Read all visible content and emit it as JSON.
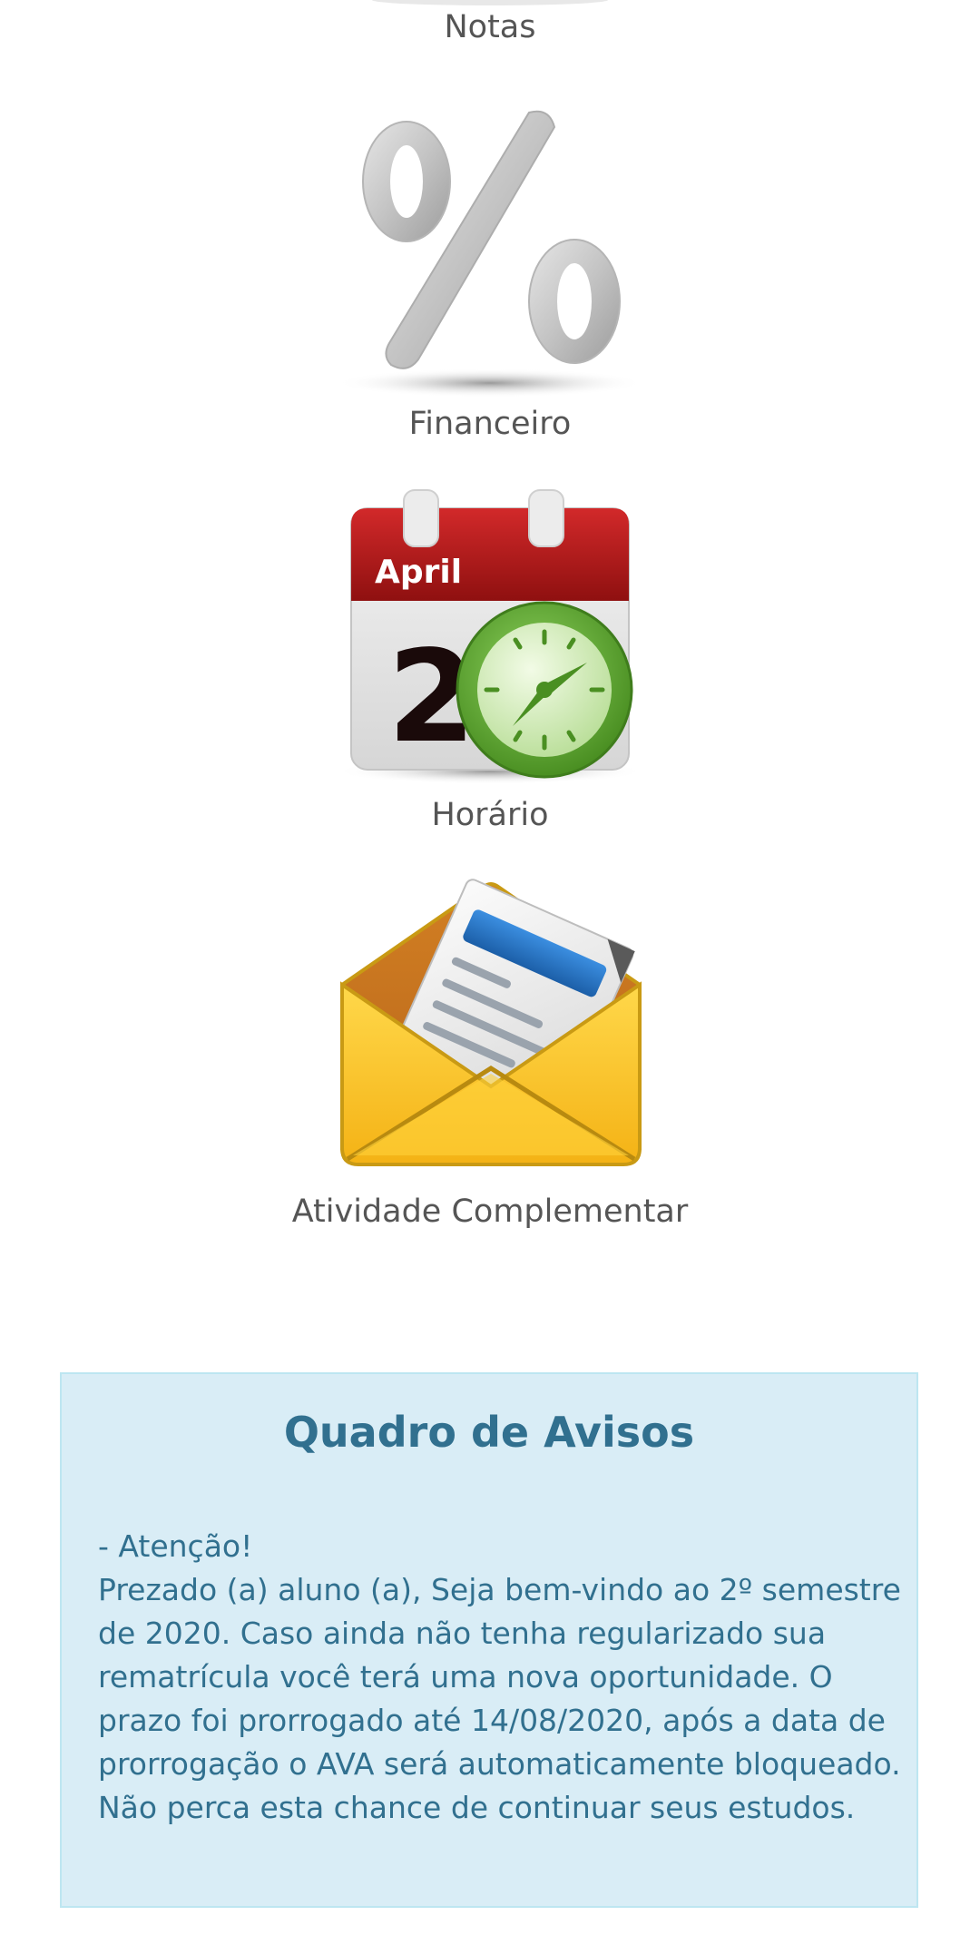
{
  "menu": {
    "items": [
      {
        "label": "Notas",
        "icon": "notas-icon"
      },
      {
        "label": "Financeiro",
        "icon": "percent-icon"
      },
      {
        "label": "Horário",
        "icon": "calendar-clock-icon",
        "calendar_month": "April",
        "calendar_day": "2"
      },
      {
        "label": "Atividade Complementar",
        "icon": "envelope-document-icon"
      }
    ]
  },
  "notice_board": {
    "title": "Quadro de Avisos",
    "heading": "- Atenção!",
    "lines": [
      "Prezado (a) aluno (a), Seja bem-vindo ao 2º semestre",
      "de 2020. Caso ainda não tenha regularizado sua",
      "rematrícula você terá uma nova oportunidade. O",
      "prazo foi prorrogado até 14/08/2020, após a data de",
      "prorrogação o AVA será automaticamente bloqueado.",
      "Não perca esta chance de continuar seus estudos."
    ]
  },
  "colors": {
    "label_text": "#555555",
    "notice_bg": "#d9edf6",
    "notice_border": "#bde6f1",
    "notice_text": "#31708f",
    "calendar_red": "#b01c1c",
    "clock_green": "#6aa83a",
    "envelope_yellow": "#f7c12a"
  }
}
